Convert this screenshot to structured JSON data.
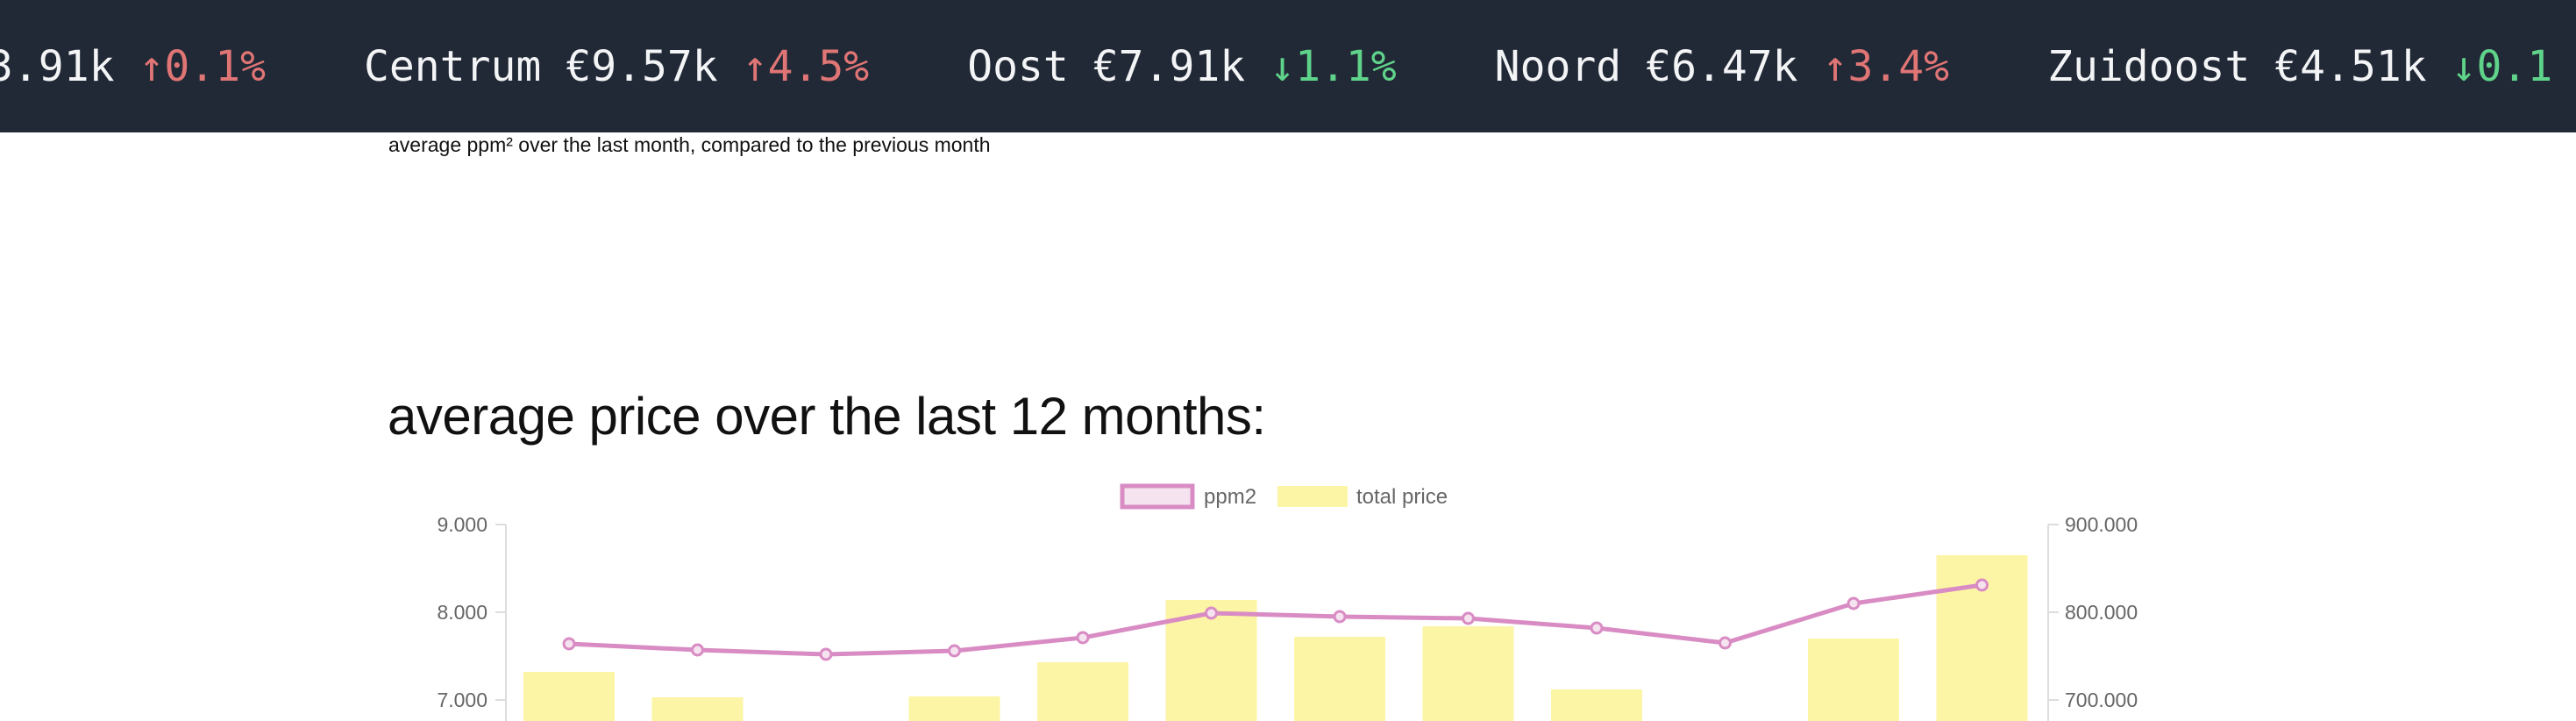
{
  "ticker": [
    {
      "name": "",
      "value": "3.91k",
      "direction": "up",
      "change": "0.1%"
    },
    {
      "name": "Centrum",
      "value": "€9.57k",
      "direction": "up",
      "change": "4.5%"
    },
    {
      "name": "Oost",
      "value": "€7.91k",
      "direction": "down",
      "change": "1.1%"
    },
    {
      "name": "Noord",
      "value": "€6.47k",
      "direction": "up",
      "change": "3.4%"
    },
    {
      "name": "Zuidoost",
      "value": "€4.51k",
      "direction": "down",
      "change": "0.1"
    }
  ],
  "subtitle": "average ppm² over the last month, compared to the previous month",
  "section_title": "average price over the last 12 months:",
  "chart_data": {
    "type": "bar",
    "legend": [
      {
        "label": "ppm2",
        "color": "#d98cc4"
      },
      {
        "label": "total price",
        "color": "#fdf5a6"
      }
    ],
    "left_axis": {
      "ticks": [
        "9.000",
        "8.000",
        "7.000"
      ],
      "range": [
        6750,
        9000
      ]
    },
    "right_axis": {
      "ticks": [
        "900.000",
        "800.000",
        "700.000"
      ],
      "range": [
        675000,
        900000
      ]
    },
    "series": [
      {
        "name": "total price",
        "type": "bar",
        "values": [
          732000,
          703000,
          null,
          704000,
          743000,
          814000,
          772000,
          784000,
          712000,
          null,
          770000,
          865000
        ]
      },
      {
        "name": "ppm2",
        "type": "line",
        "values": [
          7640,
          7570,
          7520,
          7560,
          7710,
          7990,
          7950,
          7930,
          7820,
          7650,
          8100,
          8310
        ]
      }
    ]
  }
}
